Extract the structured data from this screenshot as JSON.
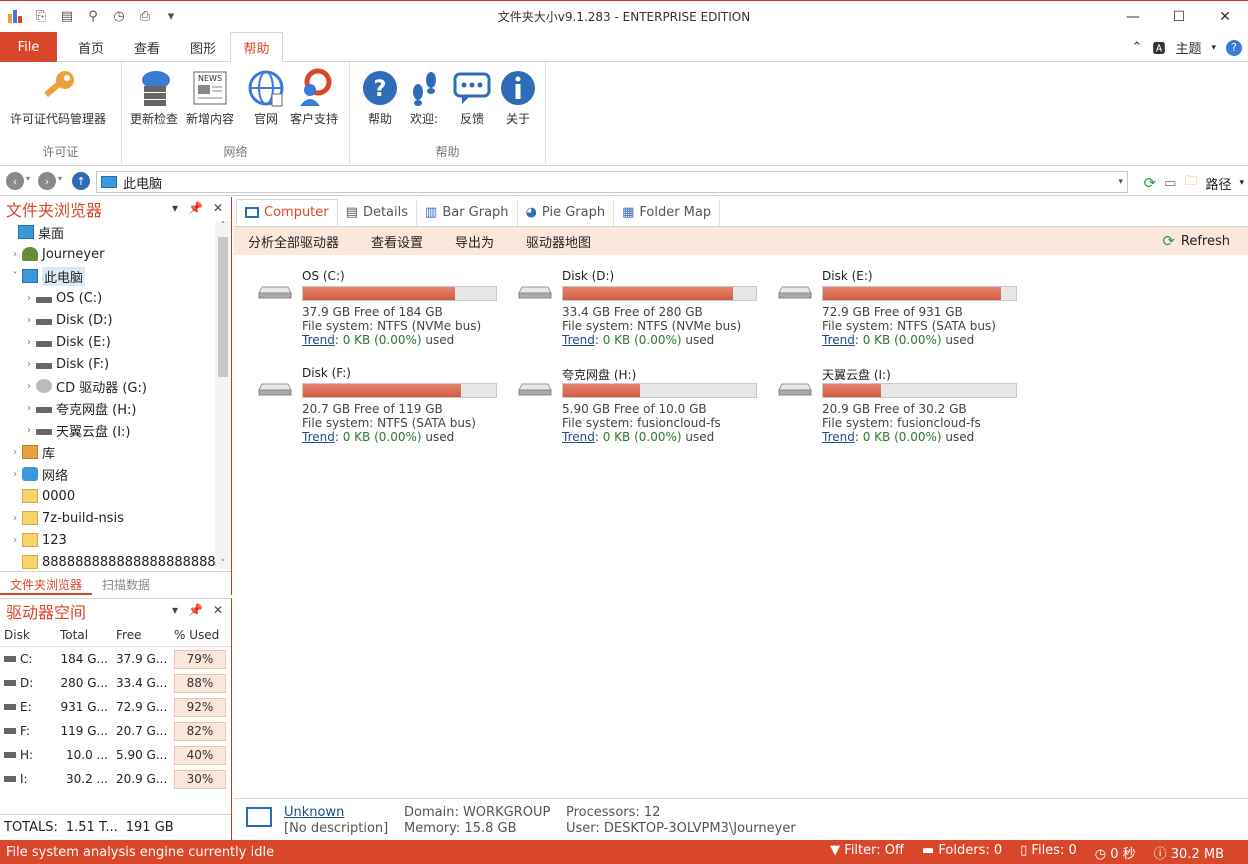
{
  "window": {
    "title": "文件夹大小v9.1.283 - ENTERPRISE EDITION",
    "minimize": "—",
    "maximize": "☐",
    "close": "✕"
  },
  "ribbon_tabs": {
    "file": "File",
    "tabs": [
      "首页",
      "查看",
      "图形",
      "帮助"
    ],
    "theme": "主题"
  },
  "ribbon": {
    "groups": [
      {
        "label": "许可证",
        "buttons": [
          "许可证代码管理器"
        ]
      },
      {
        "label": "网络",
        "buttons": [
          "更新检查",
          "新增内容",
          "官网",
          "客户支持"
        ]
      },
      {
        "label": "帮助",
        "buttons": [
          "帮助",
          "欢迎:",
          "反馈",
          "关于"
        ]
      }
    ]
  },
  "address": {
    "path": "此电脑",
    "route": "路径"
  },
  "folder_browser": {
    "title": "文件夹浏览器",
    "tree": [
      {
        "label": "桌面",
        "level": 0,
        "arrow": "",
        "icon": "desktop"
      },
      {
        "label": "Journeyer",
        "level": 1,
        "arrow": "›",
        "icon": "user"
      },
      {
        "label": "此电脑",
        "level": 1,
        "arrow": "˅",
        "icon": "pc",
        "selected": true
      },
      {
        "label": "OS (C:)",
        "level": 2,
        "arrow": "›",
        "icon": "drive"
      },
      {
        "label": "Disk (D:)",
        "level": 2,
        "arrow": "›",
        "icon": "drive"
      },
      {
        "label": "Disk (E:)",
        "level": 2,
        "arrow": "›",
        "icon": "drive"
      },
      {
        "label": "Disk (F:)",
        "level": 2,
        "arrow": "›",
        "icon": "drive"
      },
      {
        "label": "CD 驱动器 (G:)",
        "level": 2,
        "arrow": "›",
        "icon": "cd"
      },
      {
        "label": "夸克网盘 (H:)",
        "level": 2,
        "arrow": "›",
        "icon": "drive"
      },
      {
        "label": "天翼云盘 (I:)",
        "level": 2,
        "arrow": "›",
        "icon": "drive"
      },
      {
        "label": "库",
        "level": 1,
        "arrow": "›",
        "icon": "library"
      },
      {
        "label": "网络",
        "level": 1,
        "arrow": "›",
        "icon": "network"
      },
      {
        "label": "0000",
        "level": 1,
        "arrow": "",
        "icon": "folder"
      },
      {
        "label": "7z-build-nsis",
        "level": 1,
        "arrow": "›",
        "icon": "folder"
      },
      {
        "label": "123",
        "level": 1,
        "arrow": "›",
        "icon": "folder"
      },
      {
        "label": "8888888888888888888888",
        "level": 1,
        "arrow": "",
        "icon": "folder"
      }
    ],
    "tabs": [
      "文件夹浏览器",
      "扫描数据"
    ]
  },
  "drive_space": {
    "title": "驱动器空间",
    "headers": [
      "Disk",
      "Total",
      "Free",
      "% Used"
    ],
    "rows": [
      {
        "disk": "C:",
        "total": "184 G...",
        "free": "37.9 G...",
        "used": "79%"
      },
      {
        "disk": "D:",
        "total": "280 G...",
        "free": "33.4 G...",
        "used": "88%"
      },
      {
        "disk": "E:",
        "total": "931 G...",
        "free": "72.9 G...",
        "used": "92%"
      },
      {
        "disk": "F:",
        "total": "119 G...",
        "free": "20.7 G...",
        "used": "82%"
      },
      {
        "disk": "H:",
        "total": "10.0 ...",
        "free": "5.90 G...",
        "used": "40%"
      },
      {
        "disk": "I:",
        "total": "30.2 ...",
        "free": "20.9 G...",
        "used": "30%"
      }
    ],
    "totals_label": "TOTALS:",
    "totals_total": "1.51 T...",
    "totals_free": "191 GB"
  },
  "view_tabs": [
    "Computer",
    "Details",
    "Bar Graph",
    "Pie Graph",
    "Folder Map"
  ],
  "toolbar": {
    "items": [
      "分析全部驱动器",
      "查看设置",
      "导出为",
      "驱动器地图"
    ],
    "refresh": "Refresh"
  },
  "drives": [
    {
      "name": "OS (C:)",
      "used_fraction": 0.79,
      "free": "37.9 GB Free of 184 GB",
      "fs": "File system: NTFS (NVMe bus)",
      "trend_value": "0 KB (0.00%)"
    },
    {
      "name": "Disk (D:)",
      "used_fraction": 0.88,
      "free": "33.4 GB Free of 280 GB",
      "fs": "File system: NTFS (NVMe bus)",
      "trend_value": "0 KB (0.00%)"
    },
    {
      "name": "Disk (E:)",
      "used_fraction": 0.92,
      "free": "72.9 GB Free of 931 GB",
      "fs": "File system: NTFS (SATA bus)",
      "trend_value": "0 KB (0.00%)"
    },
    {
      "name": "Disk (F:)",
      "used_fraction": 0.82,
      "free": "20.7 GB Free of 119 GB",
      "fs": "File system: NTFS (SATA bus)",
      "trend_value": "0 KB (0.00%)"
    },
    {
      "name": "夸克网盘 (H:)",
      "used_fraction": 0.4,
      "free": "5.90 GB Free of 10.0 GB",
      "fs": "File system: fusioncloud-fs",
      "trend_value": "0 KB (0.00%)"
    },
    {
      "name": "天翼云盘 (I:)",
      "used_fraction": 0.3,
      "free": "20.9 GB Free of 30.2 GB",
      "fs": "File system: fusioncloud-fs",
      "trend_value": "0 KB (0.00%)"
    }
  ],
  "trend_label": "Trend",
  "used_label": "used",
  "computer_info": {
    "name": "Unknown",
    "description": "[No description]",
    "domain": "Domain: WORKGROUP",
    "memory": "Memory: 15.8 GB",
    "processors": "Processors: 12",
    "user": "User: DESKTOP-3OLVPM3\\Journeyer"
  },
  "status": {
    "message": "File system analysis engine currently idle",
    "filter": "Filter: Off",
    "folders": "Folders: 0",
    "files": "Files: 0",
    "time": "0 秒",
    "memory": "30.2 MB"
  },
  "colors": {
    "accent": "#d9472b",
    "bar_fill": "#d35a42",
    "toolbar_bg": "#fbe7dc",
    "link": "#1f4e8c"
  }
}
